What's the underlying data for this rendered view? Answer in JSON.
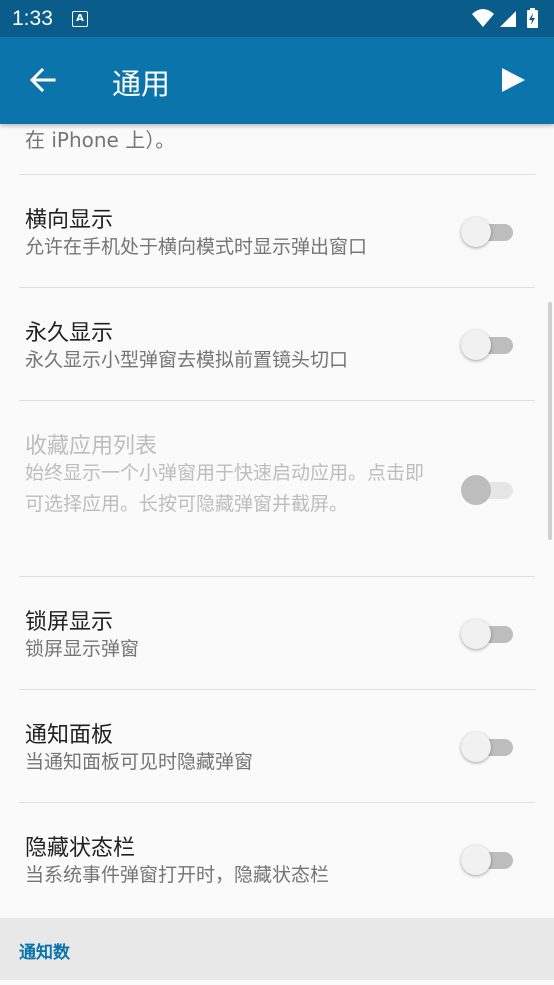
{
  "status_bar": {
    "time": "1:33",
    "notif_letter": "A",
    "icons": [
      "wifi-icon",
      "signal-icon",
      "battery-charging-icon"
    ]
  },
  "app_bar": {
    "title": "通用",
    "back_icon": "arrow-left-icon",
    "play_icon": "play-icon"
  },
  "partial_text": "在 iPhone 上）。",
  "settings": [
    {
      "title": "横向显示",
      "subtitle": "允许在手机处于横向模式时显示弹出窗口",
      "enabled": true,
      "checked": false
    },
    {
      "title": "永久显示",
      "subtitle": "永久显示小型弹窗去模拟前置镜头切口",
      "enabled": true,
      "checked": false
    },
    {
      "title": "收藏应用列表",
      "subtitle": "始终显示一个小弹窗用于快速启动应用。点击即可选择应用。长按可隐藏弹窗并截屏。",
      "enabled": false,
      "checked": false
    },
    {
      "title": "锁屏显示",
      "subtitle": "锁屏显示弹窗",
      "enabled": true,
      "checked": false
    },
    {
      "title": "通知面板",
      "subtitle": "当通知面板可见时隐藏弹窗",
      "enabled": true,
      "checked": false
    },
    {
      "title": "隐藏状态栏",
      "subtitle": "当系统事件弹窗打开时，隐藏状态栏",
      "enabled": true,
      "checked": false
    }
  ],
  "section_header": "通知数",
  "colors": {
    "app_bar": "#0b74aa",
    "status_bar": "#0a5d8a",
    "accent": "#0b74aa"
  }
}
